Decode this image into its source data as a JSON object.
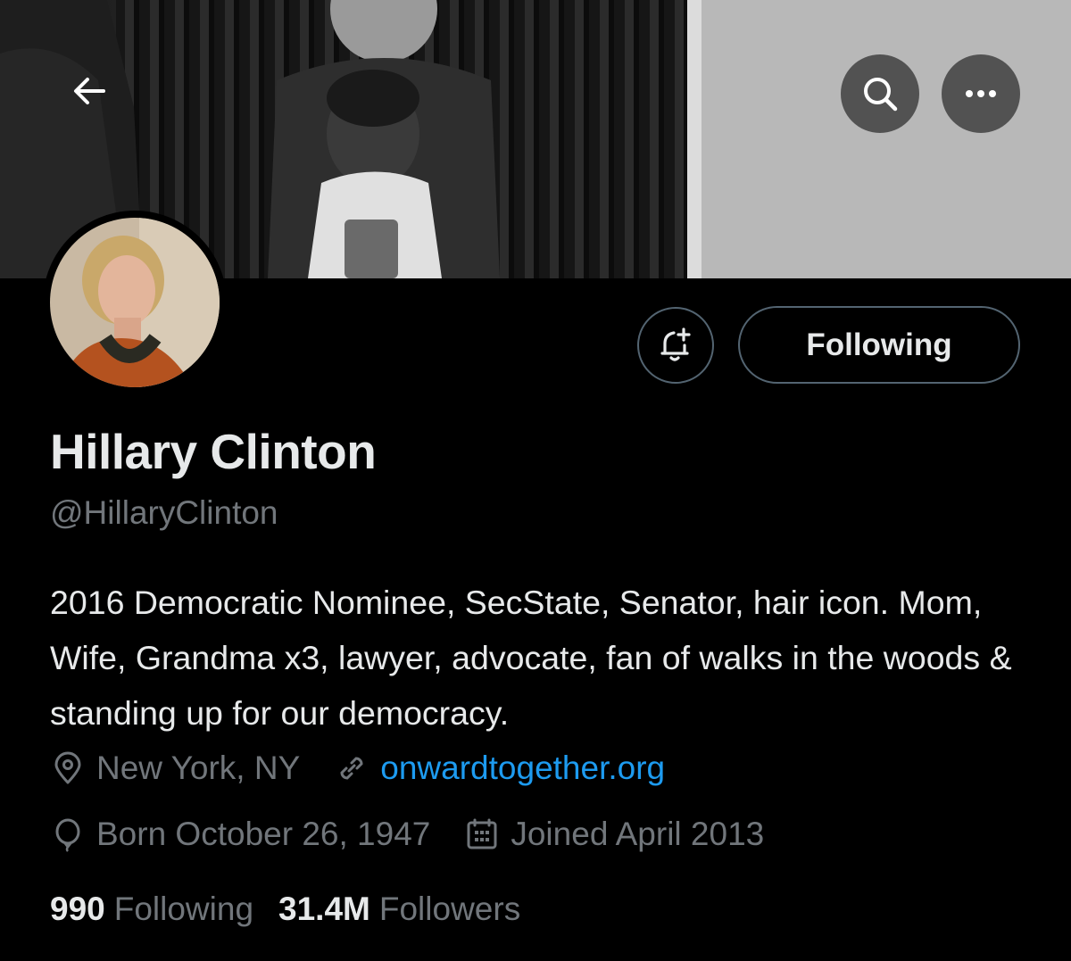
{
  "profile": {
    "display_name": "Hillary Clinton",
    "handle": "@HillaryClinton",
    "bio": "2016 Democratic Nominee, SecState, Senator, hair icon. Mom, Wife, Grandma x3, lawyer, advocate, fan of walks in the woods & standing up for our democracy.",
    "location": "New York, NY",
    "website": "onwardtogether.org",
    "birthday": "Born October 26, 1947",
    "joined": "Joined April 2013"
  },
  "actions": {
    "following_label": "Following"
  },
  "stats": {
    "following_count": "990",
    "following_label": "Following",
    "followers_count": "31.4M",
    "followers_label": "Followers"
  },
  "icons": {
    "back": "arrow-left-icon",
    "search": "search-icon",
    "more": "more-horizontal-icon",
    "notify": "bell-plus-icon",
    "location": "location-pin-icon",
    "link": "link-icon",
    "birthday": "balloon-icon",
    "calendar": "calendar-icon"
  },
  "colors": {
    "background": "#000000",
    "primary_text": "#e7e9ea",
    "secondary_text": "#71767b",
    "link": "#1d9bf0",
    "border": "#536471"
  }
}
